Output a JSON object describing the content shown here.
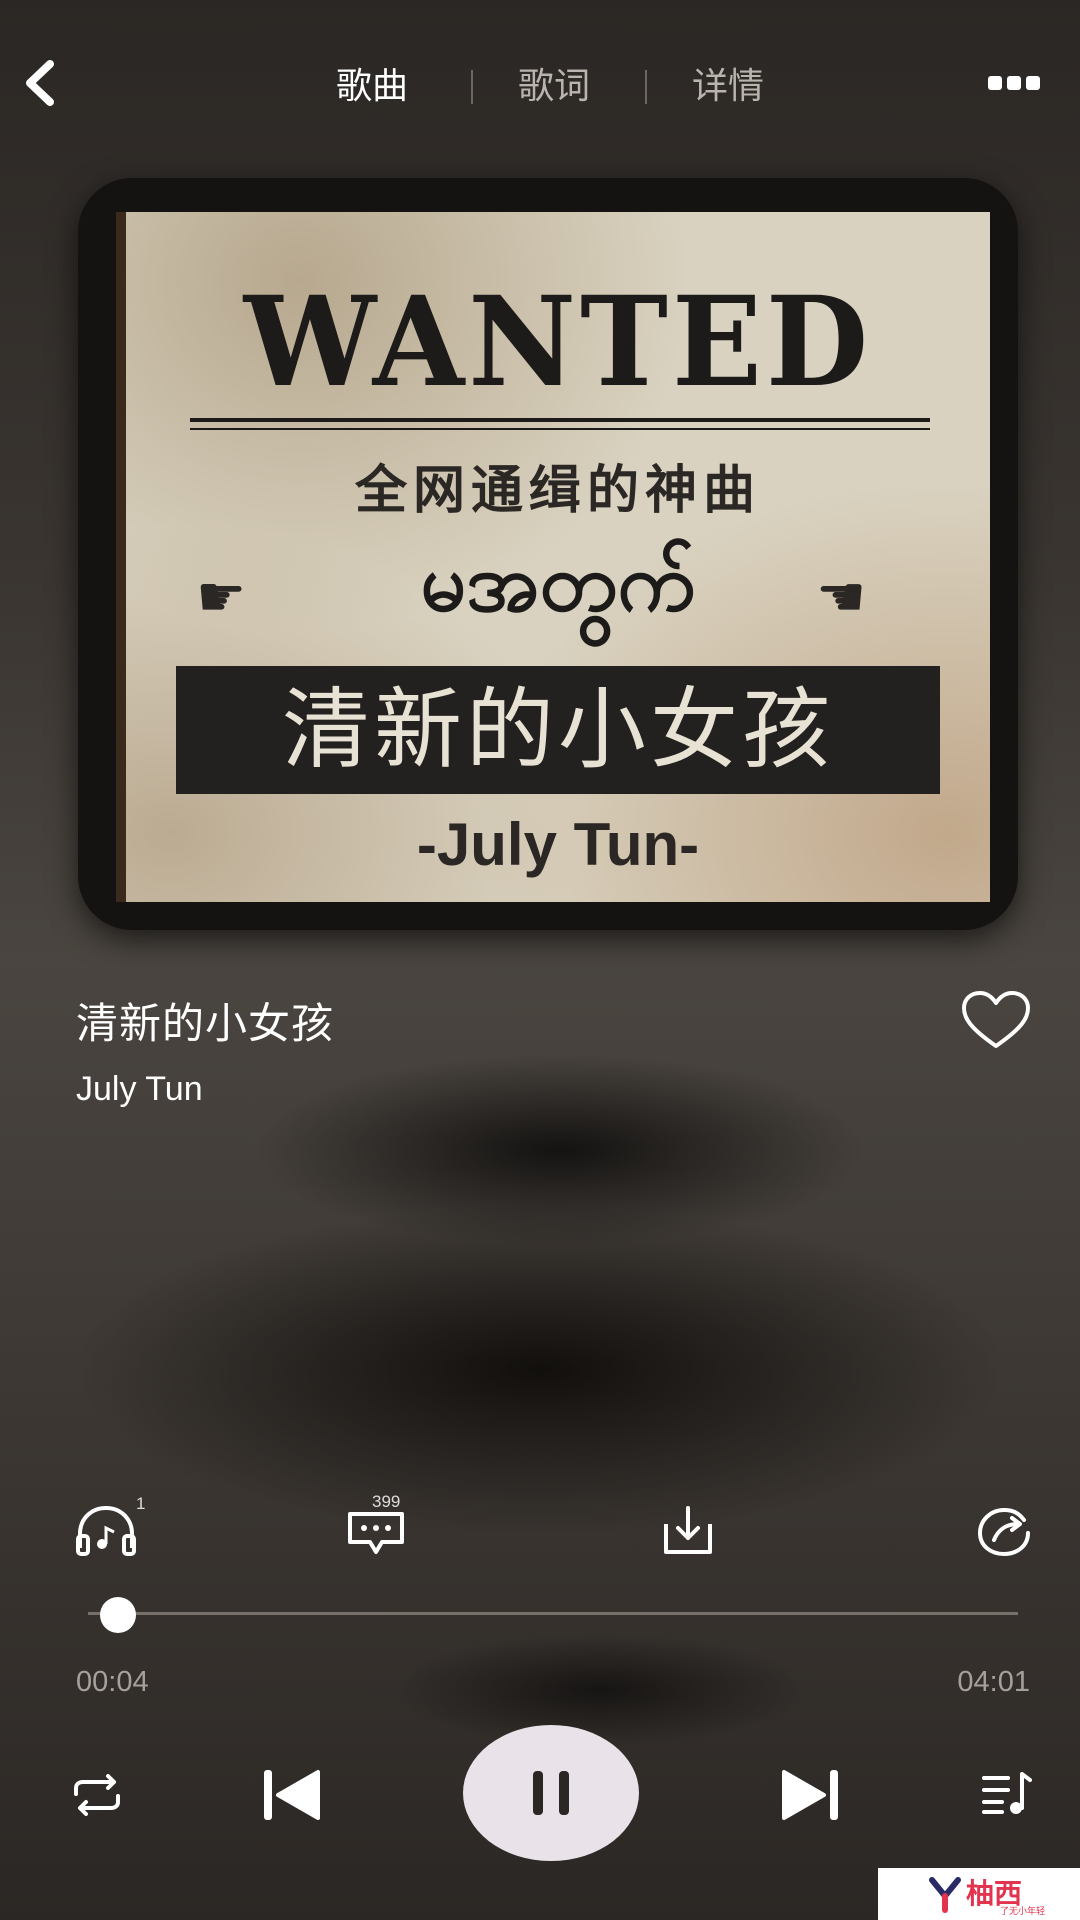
{
  "header": {
    "tabs": [
      {
        "label": "歌曲",
        "active": true
      },
      {
        "label": "歌词",
        "active": false
      },
      {
        "label": "详情",
        "active": false
      }
    ],
    "back_icon": "chevron-left-icon",
    "more_icon": "more-dots-icon"
  },
  "album_art": {
    "headline": "WANTED",
    "subtitle": "全网通缉的神曲",
    "burmese": "မအတွက်",
    "band_title": "清新的小女孩",
    "artist": "-July Tun-"
  },
  "song": {
    "title": "清新的小女孩",
    "artist": "July Tun",
    "favorite_icon": "heart-outline-icon"
  },
  "actions": {
    "listeners_badge": "1",
    "comments_badge": "399",
    "icons": [
      "headphones-icon",
      "comment-icon",
      "download-icon",
      "share-icon"
    ]
  },
  "progress": {
    "elapsed": "00:04",
    "total": "04:01",
    "fraction": 0.017
  },
  "controls": {
    "icons": [
      "repeat-icon",
      "previous-icon",
      "pause-icon",
      "next-icon",
      "playlist-icon"
    ],
    "state": "playing"
  },
  "watermark": {
    "text": "柚西",
    "small_text": "了无小年轻"
  },
  "colors": {
    "background": "#3a3531",
    "play_button": "#e9e2e8",
    "watermark": "#e2344f"
  }
}
